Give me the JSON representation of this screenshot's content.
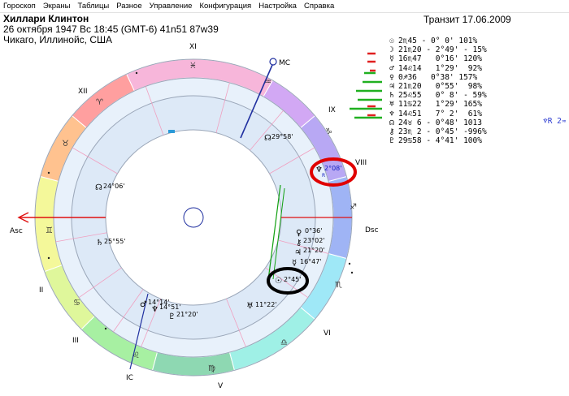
{
  "menu": [
    "Гороскоп",
    "Экраны",
    "Таблицы",
    "Разное",
    "Управление",
    "Конфигурация",
    "Настройка",
    "Справка"
  ],
  "header": {
    "name": "Хиллари Клинтон",
    "date_line": "26 октября 1947  Вс  18:45 (GMT-6) 41n51  87w39",
    "place": "Чикаго, Иллинойс, США"
  },
  "transit": "Транзит 17.06.2009",
  "colors": {
    "mc_axis": "#2030a0",
    "asc_axis": "#e01010",
    "aspect_line": "#10a010",
    "red_ellipse": "#e00000",
    "black_ellipse": "#000000"
  },
  "axes": {
    "mc": "MC",
    "asc": "Asc",
    "dsc": "Dsc",
    "ic": "IC"
  },
  "houses": [
    "XII",
    "XI",
    "IX",
    "VIII",
    "II",
    "III",
    "IC",
    "V",
    "VI"
  ],
  "zodiac_glyphs": [
    {
      "name": "pisces-glyph",
      "g": "♓"
    },
    {
      "name": "aquarius-glyph",
      "g": "♒"
    },
    {
      "name": "aries-glyph",
      "g": "♈"
    },
    {
      "name": "taurus-glyph",
      "g": "♉"
    },
    {
      "name": "capricorn-glyph",
      "g": "♑"
    },
    {
      "name": "gemini-glyph",
      "g": "♊"
    },
    {
      "name": "sagittarius-glyph",
      "g": "♐"
    },
    {
      "name": "cancer-glyph",
      "g": "♋"
    },
    {
      "name": "scorpio-glyph",
      "g": "♏"
    },
    {
      "name": "leo-glyph",
      "g": "♌"
    },
    {
      "name": "libra-glyph",
      "g": "♎"
    },
    {
      "name": "virgo-glyph",
      "g": "♍"
    }
  ],
  "chart_labels": {
    "venus_like": "29°58'",
    "neptune_transit": "2°08'",
    "node": "24°06'",
    "moon_like": "25°55'",
    "p1": "0°36'",
    "p2": "23°02'",
    "p3": "21°20'",
    "p4": "16°47'",
    "sun": "2°45'",
    "neptune": "11°22'",
    "mars": "14°14'",
    "pluto": "14°51'",
    "mercury": "21°20'"
  },
  "table": [
    {
      "g": "☉",
      "t": "2♏45 - 0° 0' 101%"
    },
    {
      "g": "☽",
      "t": "21♏20 - 2°49' - 15%"
    },
    {
      "g": "☿",
      "t": "16♏47   0°16' 120%"
    },
    {
      "g": "♂",
      "t": "14♌14   1°29'  92%"
    },
    {
      "g": "♀",
      "t": "0♐36   0°38' 157%"
    },
    {
      "g": "♃",
      "t": "21♏20   0°55'  98%"
    },
    {
      "g": "♄",
      "t": "25♌55   0° 8' - 59%"
    },
    {
      "g": "♅",
      "t": "11♋22   1°29' 165%"
    },
    {
      "g": "♆",
      "t": "14♌51   7° 2'  61%"
    },
    {
      "g": "☊",
      "t": "24♉ 6 - 0°48' 1013"
    },
    {
      "g": "⚷",
      "t": "23♏ 2 - 0°45' -996%"
    },
    {
      "g": "♇",
      "t": "29♋58 - 4°41' 100%"
    }
  ],
  "extra_text": "♆R 2♒ 8"
}
